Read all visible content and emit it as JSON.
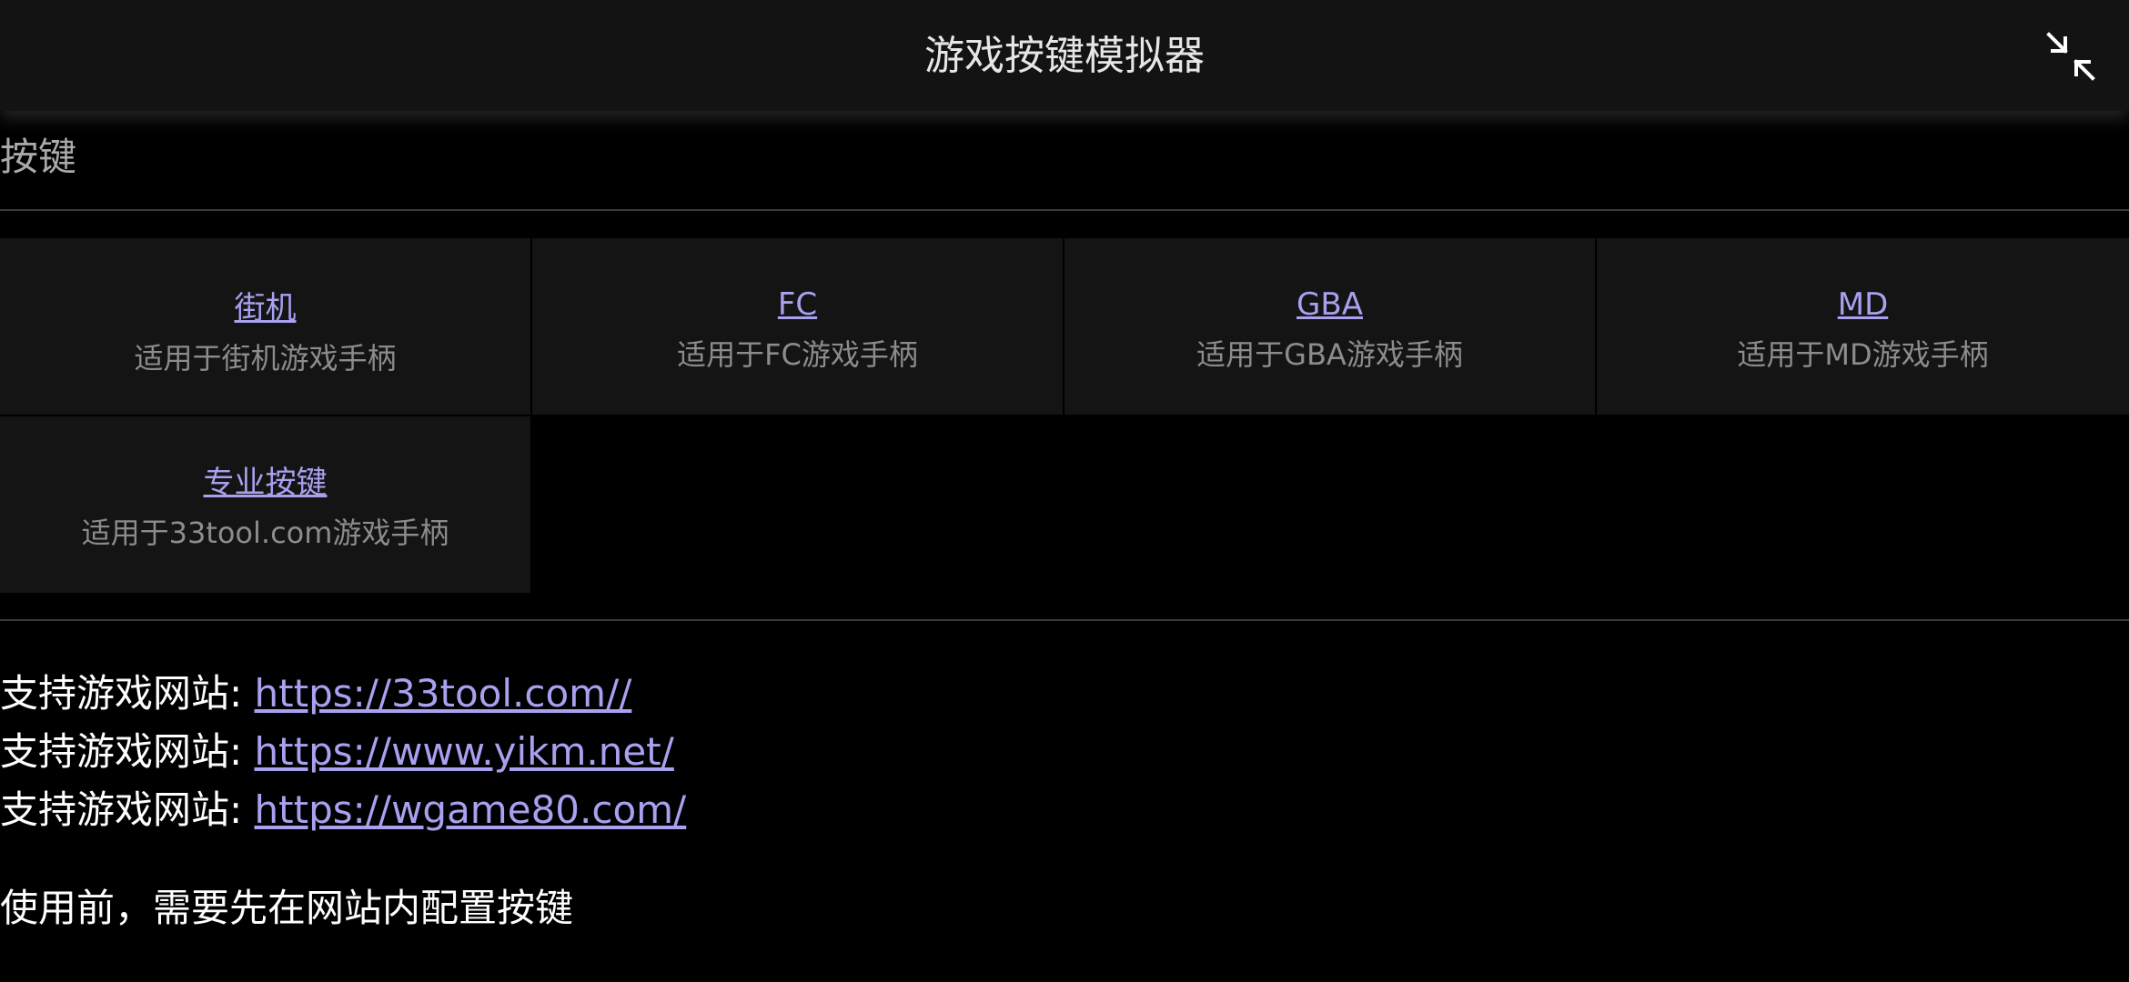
{
  "header": {
    "title": "游戏按键模拟器",
    "collapse_icon": "collapse-arrows-icon"
  },
  "section": {
    "title": "按键"
  },
  "modes": [
    {
      "label": "街机",
      "desc": "适用于街机游戏手柄"
    },
    {
      "label": "FC",
      "desc": "适用于FC游戏手柄"
    },
    {
      "label": "GBA",
      "desc": "适用于GBA游戏手柄"
    },
    {
      "label": "MD",
      "desc": "适用于MD游戏手柄"
    },
    {
      "label": "专业按键",
      "desc": "适用于33tool.com游戏手柄"
    }
  ],
  "sites": [
    {
      "label": "支持游戏网站: ",
      "url": "https://33tool.com//"
    },
    {
      "label": "支持游戏网站: ",
      "url": "https://www.yikm.net/"
    },
    {
      "label": "支持游戏网站: ",
      "url": "https://wgame80.com/"
    }
  ],
  "note": "使用前，需要先在网站内配置按键",
  "colors": {
    "background": "#000000",
    "topbar": "#131313",
    "card": "#141414",
    "link": "#a7a1f0",
    "muted": "#8c8c8c"
  }
}
